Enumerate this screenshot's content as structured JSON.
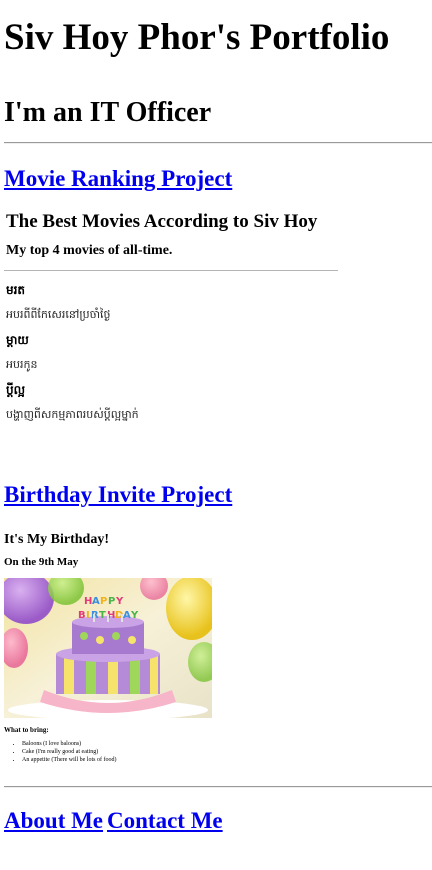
{
  "header": {
    "title": "Siv Hoy Phor's Portfolio",
    "subtitle": "I'm an IT Officer"
  },
  "projects": [
    {
      "link": "Movie Ranking Project"
    },
    {
      "link": "Birthday Invite Project"
    }
  ],
  "movie_ranking": {
    "heading": "The Best Movies According to Siv Hoy",
    "tagline": "My top 4 movies of all-time.",
    "movies": [
      {
        "title": "មរត",
        "description": "អបរពីពីកែសេរនៅប្រចាំថ្ងៃ"
      },
      {
        "title": "ម្ដាយ",
        "description": "អបរកូន"
      },
      {
        "title": "ប្ដីល្អ",
        "description": "បង្ហាញពីសកម្មភាពរបស់ប្តីល្អម្នាក់"
      }
    ]
  },
  "birthday_invite": {
    "heading": "It's My Birthday!",
    "date": "On the 9th May",
    "cake_text": "HAPPY BIRTHDAY",
    "bring_title": "What to bring:",
    "items": [
      "Baloons (I love baloons)",
      "Cake (I'm really good at eating)",
      "An appetite (There will be lots of food)"
    ]
  },
  "footer": {
    "about_link": "About Me",
    "contact_link": "Contact Me"
  },
  "colors": {
    "link": "#0000ee",
    "rule": "#9a9a9a"
  }
}
